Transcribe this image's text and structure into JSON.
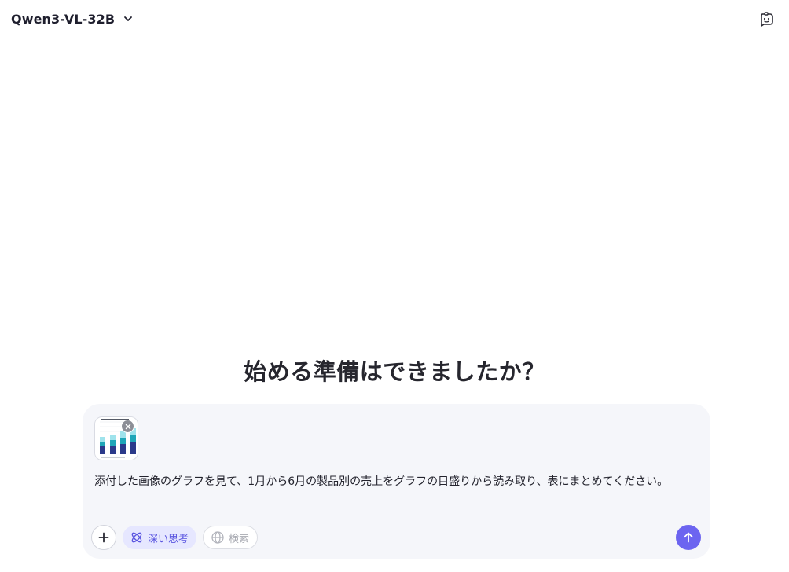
{
  "header": {
    "model_name": "Qwen3-VL-32B",
    "model_dropdown_icon": "chevron-down-icon",
    "new_chat_icon": "chat-bot-icon"
  },
  "main": {
    "hero_title": "始める準備はできましたか？"
  },
  "composer": {
    "attachment": {
      "type": "image",
      "icon": "chart-thumbnail",
      "remove_icon": "close-icon"
    },
    "prompt_value": "添付した画像のグラフを見て、1月から6月の製品別の売上をグラフの目盛りから読み取り、表にまとめてください。",
    "tools": {
      "add_icon": "plus-icon",
      "deep_thinking_label": "深い思考",
      "deep_thinking_icon": "atom-icon",
      "deep_thinking_active": true,
      "search_label": "検索",
      "search_icon": "globe-icon",
      "search_active": false
    },
    "send_icon": "arrow-up-icon",
    "accent_color": "#6c64f0"
  }
}
